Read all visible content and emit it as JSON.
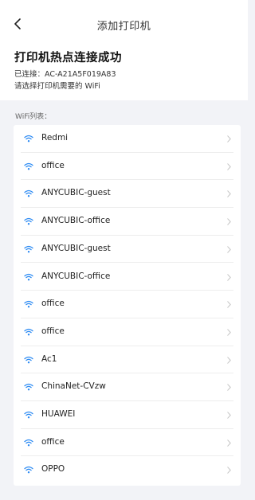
{
  "nav": {
    "title": "添加打印机"
  },
  "header": {
    "title": "打印机热点连接成功",
    "connected": "已连接：AC-A21A5F019A83",
    "hint": "请选择打印机需要的 WiFi"
  },
  "wifi_list": {
    "label": "WiFi列表：",
    "icon": "wifi-icon",
    "icon_color": "#2f8cf3",
    "items": [
      {
        "name": "Redmi"
      },
      {
        "name": "office"
      },
      {
        "name": "ANYCUBIC-guest"
      },
      {
        "name": "ANYCUBIC-office"
      },
      {
        "name": "ANYCUBIC-guest"
      },
      {
        "name": "ANYCUBIC-office"
      },
      {
        "name": "office"
      },
      {
        "name": "office"
      },
      {
        "name": "Ac1"
      },
      {
        "name": "ChinaNet-CVzw"
      },
      {
        "name": "HUAWEI"
      },
      {
        "name": "office"
      },
      {
        "name": "OPPO"
      }
    ]
  }
}
